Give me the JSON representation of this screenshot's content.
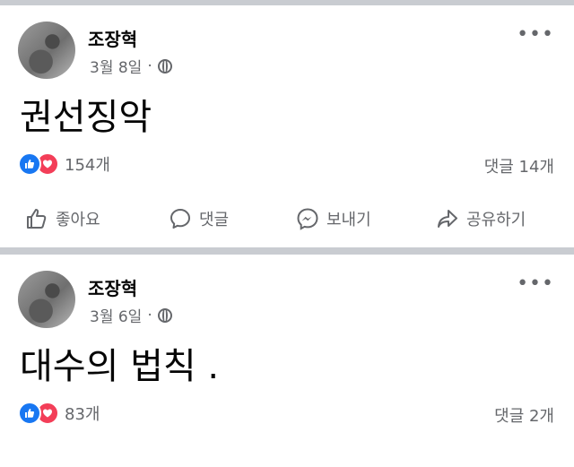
{
  "posts": [
    {
      "author": "조장혁",
      "date": "3월 8일",
      "separator": "·",
      "more": "•••",
      "text": "권선징악",
      "reaction_count": "154개",
      "comment_count": "댓글 14개",
      "actions": {
        "like": "좋아요",
        "comment": "댓글",
        "send": "보내기",
        "share": "공유하기"
      }
    },
    {
      "author": "조장혁",
      "date": "3월 6일",
      "separator": "·",
      "more": "•••",
      "text": "대수의 법칙 .",
      "reaction_count": "83개",
      "comment_count": "댓글 2개"
    }
  ],
  "icons": {
    "like": "thumbs-up-icon",
    "love": "heart-icon",
    "globe": "globe-icon",
    "comment": "speech-bubble-icon",
    "messenger": "messenger-icon",
    "share": "share-arrow-icon"
  },
  "colors": {
    "like": "#1877f2",
    "love": "#f33e58",
    "muted_text": "#65676b",
    "separator": "#c9ccd1"
  }
}
